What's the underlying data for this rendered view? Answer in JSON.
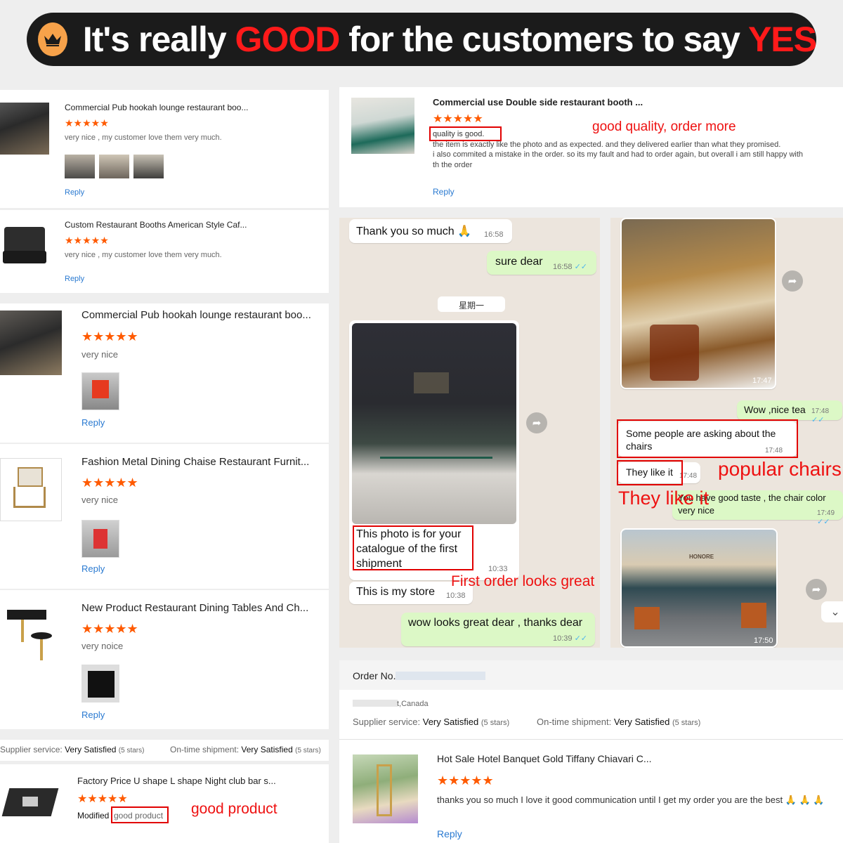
{
  "banner": {
    "part1": "It's really ",
    "good": "GOOD",
    "part2": " for the customers to say ",
    "yes": "YES"
  },
  "stars": "★★★★★",
  "left_reviews": [
    {
      "title": "Commercial Pub hookah lounge restaurant boo...",
      "text": "very nice , my customer love them very much.",
      "reply": "Reply"
    },
    {
      "title": "Custom Restaurant Booths American Style Caf...",
      "text": "very nice , my customer love them very much.",
      "reply": "Reply"
    },
    {
      "title": "Commercial Pub hookah lounge restaurant boo...",
      "text": "very nice",
      "reply": "Reply"
    },
    {
      "title": "Fashion Metal Dining Chaise Restaurant Furnit...",
      "text": "very nice",
      "reply": "Reply"
    },
    {
      "title": "New Product Restaurant Dining Tables And Ch...",
      "text": "very noice",
      "reply": "Reply"
    }
  ],
  "left_summary": {
    "supplier_label": "Supplier service:",
    "supplier_value": "Very Satisfied",
    "supplier_stars": "(5 stars)",
    "ontime_label": "On-time shipment:",
    "ontime_value": "Very Satisfied",
    "ontime_stars": "(5 stars)"
  },
  "left_last": {
    "title": "Factory Price U shape L shape Night club bar s...",
    "modified_label": "Modified",
    "boxed_text": "good product",
    "annotation": "good product",
    "reply": "Reply"
  },
  "top_right": {
    "title": "Commercial use Double side restaurant booth ...",
    "boxed_text": "quality is good.",
    "annotation": "good quality, order more",
    "line1": "the item is exactly like the photo and as expected. and they delivered earlier than what they promised.",
    "line2": "i also commited a mistake in the order. so its my fault and had to order again, but overall i am still happy with",
    "line3": "th the order",
    "reply": "Reply"
  },
  "chat1": {
    "msg1": "Thank you so much 🙏",
    "msg1_time": "16:58",
    "msg2": "sure dear",
    "msg2_time": "16:58",
    "date_chip": "星期一",
    "photo_caption": "This photo is for your catalogue of the first shipment",
    "photo_time": "10:33",
    "msg3": "This is my store",
    "msg3_time": "10:38",
    "annotation": "First order looks great",
    "msg4": "wow looks great dear , thanks dear",
    "msg4_time": "10:39"
  },
  "chat2": {
    "photo1_time": "17:47",
    "msg1": "Wow ,nice tea",
    "msg1_time": "17:48",
    "msg2": "Some people are asking about the chairs",
    "msg2_time": "17:48",
    "msg3": "They like it",
    "msg3_time": "17:48",
    "annotation1": "popular chairs",
    "annotation2": "They like it",
    "msg4": "You have good taste , the chair color very nice",
    "msg4_time": "17:49",
    "photo2_sign": "HONORE",
    "photo2_time": "17:50"
  },
  "bottom_right": {
    "order_label": "Order No.:",
    "location": "t,Canada",
    "supplier_label": "Supplier service:",
    "supplier_value": "Very Satisfied",
    "supplier_stars": "(5 stars)",
    "ontime_label": "On-time shipment:",
    "ontime_value": "Very Satisfied",
    "ontime_stars": "(5 stars)",
    "title": "Hot Sale Hotel Banquet Gold Tiffany Chiavari C...",
    "text": "thanks you so much I love it good communication until I get my order you are the best 🙏 🙏 🙏",
    "reply": "Reply"
  },
  "colors": {
    "accent_red": "#ff1a1a",
    "star": "#ff5a00",
    "link": "#2a7ad1",
    "chat_me": "#dcf8c6"
  }
}
